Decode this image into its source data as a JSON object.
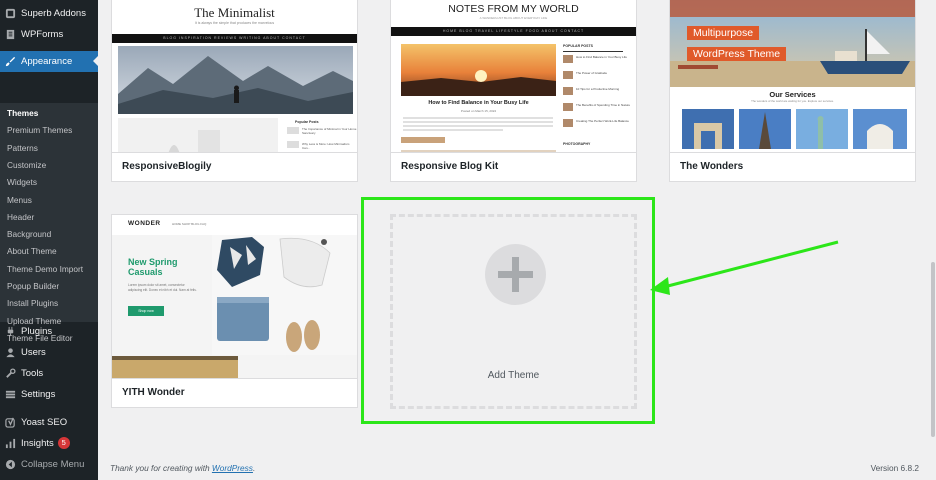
{
  "sidebar": {
    "top_items": [
      {
        "label": "Superb Addons",
        "icon": "superb-addons-icon"
      },
      {
        "label": "WPForms",
        "icon": "wpforms-icon"
      },
      {
        "label": "Appearance",
        "icon": "paintbrush-icon"
      }
    ],
    "appearance_submenu": [
      "Themes",
      "Premium Themes",
      "Patterns",
      "Customize",
      "Widgets",
      "Menus",
      "Header",
      "Background",
      "About Theme",
      "Theme Demo Import",
      "Popup Builder",
      "Install Plugins",
      "Upload Theme",
      "Theme File Editor"
    ],
    "bottom_items": [
      {
        "label": "Plugins",
        "icon": "plugin-icon"
      },
      {
        "label": "Users",
        "icon": "users-icon"
      },
      {
        "label": "Tools",
        "icon": "wrench-icon"
      },
      {
        "label": "Settings",
        "icon": "settings-icon"
      },
      {
        "label": "Yoast SEO",
        "icon": "yoast-icon"
      },
      {
        "label": "Insights",
        "icon": "insights-icon",
        "badge": "5"
      },
      {
        "label": "Collapse Menu",
        "icon": "collapse-icon"
      }
    ]
  },
  "themes": [
    {
      "name": "ResponsiveBlogily",
      "preview": {
        "title": "The Minimalist",
        "tagline": "It is always the simple that produces the marvelous",
        "nav": "BLOG   INSPIRATION   REVIEWS   WRITING   ABOUT   CONTACT",
        "widget_title": "Popular Posts",
        "post_1": "The Importance of Minimal in Your Home Sanctuary",
        "post_2": "Why Less is More: How Minimalism Can..."
      }
    },
    {
      "name": "Responsive Blog Kit",
      "preview": {
        "title": "NOTES FROM MY WORLD",
        "tagline": "A WANDERLUST BLOG ABOUT EVERYDAY LIFE",
        "nav": "HOME   BLOG   TRAVEL   LIFESTYLE   FOOD   ABOUT   CONTACT",
        "post_title": "How to Find Balance in Your Busy Life",
        "post_meta": "Posted on March 15, 2024",
        "sidebar_title": "POPULAR POSTS",
        "sidebar_posts": [
          "How to Find Balance in Your Busy Life",
          "The Power of Gratitude",
          "10 Tips for a Productive Morning",
          "The Benefits of Spending Time in Nature",
          "Creating The Perfect Work-Life Balance"
        ],
        "section": "PHOTOGRAPHY"
      }
    },
    {
      "name": "The Wonders",
      "preview": {
        "banner_line_1": "Multipurpose",
        "banner_line_2": "WordPress Theme",
        "services_title": "Our Services",
        "services_sub": "The wonders of the world are waiting for you. Explore our services."
      }
    },
    {
      "name": "YITH Wonder",
      "preview": {
        "logo": "WONDER",
        "nav": "HOME   SHOP   BLOG   FAQ",
        "headline": "New Spring Casuals",
        "body": "Lorem ipsum dolor sit amet, consectetur adipiscing elit. Donec et nibh et dui. Nam at felis.",
        "button": "Shop now"
      }
    }
  ],
  "add_theme": {
    "label": "Add Theme"
  },
  "footer": {
    "thank_you_prefix": "Thank you for creating with ",
    "thank_you_link": "WordPress",
    "thank_you_suffix": ".",
    "version": "Version 6.8.2"
  },
  "colors": {
    "sidebar_bg": "#1d2327",
    "submenu_bg": "#2c3338",
    "active_blue": "#2271b1",
    "highlight_green": "#2ce619",
    "badge_red": "#d63638"
  }
}
